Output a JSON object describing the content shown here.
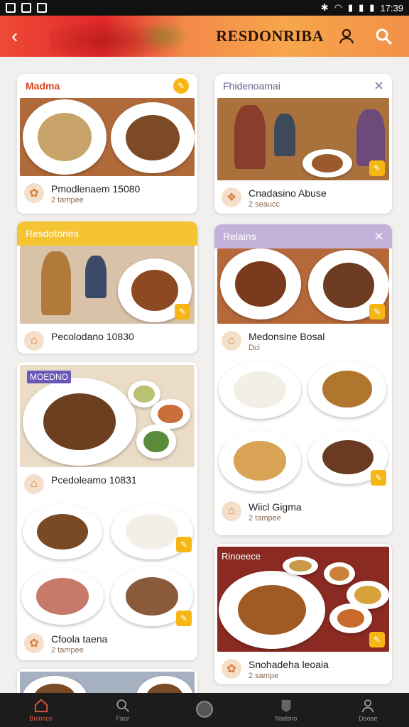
{
  "status_bar": {
    "time": "17:39"
  },
  "app_bar": {
    "title": "RESDONRIBA"
  },
  "cards": [
    {
      "header": "Madma",
      "title": "Pmodlenaem 15080",
      "sub": "2 tampee"
    },
    {
      "header": "Fhidenoamai",
      "title": "Cnadasino Abuse",
      "sub": "2 seaucc"
    },
    {
      "header": "Resdotones",
      "title": "Pecolodano 10830"
    },
    {
      "header": "Relains",
      "title": "Medonsine Bosal",
      "sub": "Dci"
    },
    {
      "header": "MOEDNO",
      "title": "Pcedoleamo 10831"
    },
    {
      "title": "Cfoola taena",
      "sub": "2 tampee"
    },
    {
      "title": "Wiicl Gigma",
      "sub": "2 tampee"
    },
    {
      "header": "Rinoeece",
      "title": "Snohadeha leoaia",
      "sub": "2 sampe"
    }
  ],
  "nav": [
    {
      "label": "Bninnco",
      "icon": "home-icon"
    },
    {
      "label": "Faor",
      "icon": "search-icon"
    },
    {
      "label": "",
      "icon": "circle-icon"
    },
    {
      "label": "Nadsiro",
      "icon": "tag-icon"
    },
    {
      "label": "Dooae",
      "icon": "profile-icon"
    }
  ],
  "colors": {
    "accent": "#f6b613",
    "brand": "#e8553a",
    "purple": "#7e6aa8"
  }
}
